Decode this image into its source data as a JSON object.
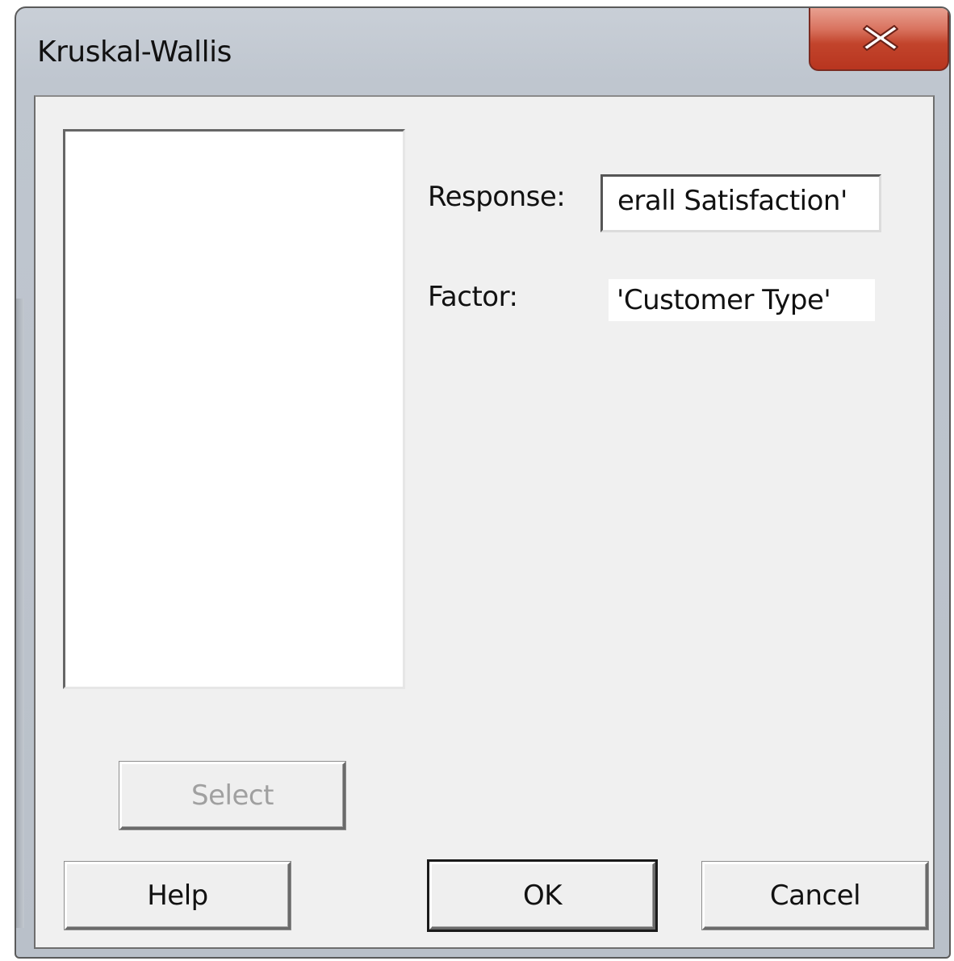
{
  "window": {
    "title": "Kruskal-Wallis"
  },
  "form": {
    "response_label": "Response:",
    "response_value": "erall Satisfaction'",
    "factor_label": "Factor:",
    "factor_value": "'Customer Type'"
  },
  "buttons": {
    "select": "Select",
    "help": "Help",
    "ok": "OK",
    "cancel": "Cancel"
  },
  "icons": {
    "close": "close-icon"
  },
  "colors": {
    "close_button": "#c2442c",
    "dialog_background": "#f0f0f0",
    "disabled_text": "#a0a0a0"
  }
}
